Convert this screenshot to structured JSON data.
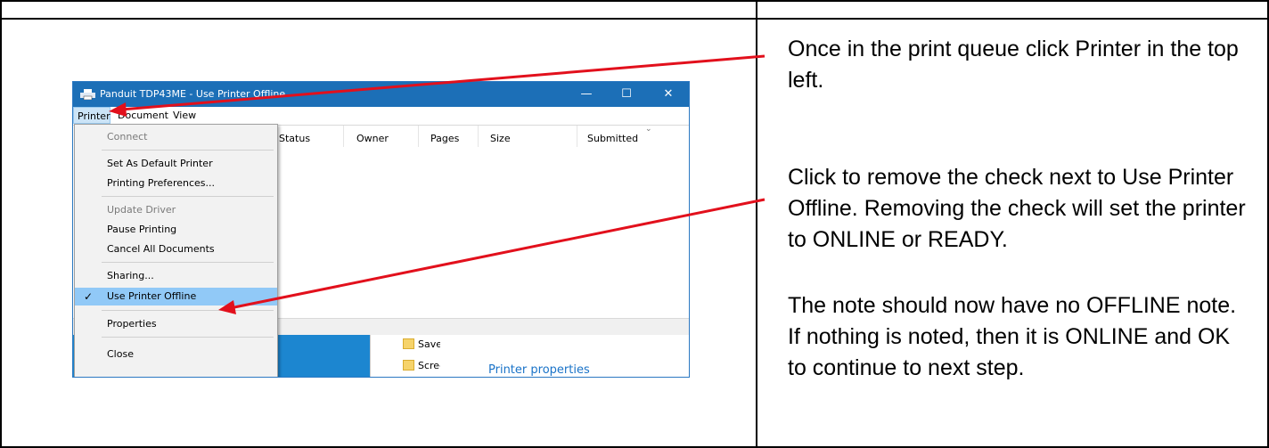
{
  "instructions": [
    "Once in the print queue click Printer in the top left.",
    "Click to remove the check next to Use Printer Offline.  Removing the check will set the printer to ONLINE or READY.",
    "The note should now have no OFFLINE note.  If nothing is noted, then it is ONLINE and OK to continue to next step."
  ],
  "window": {
    "title": "Panduit TDP43ME  - Use Printer Offline",
    "buttons": {
      "minimize": "—",
      "maximize": "☐",
      "close": "✕"
    },
    "menubar": [
      "Printer",
      "Document",
      "View"
    ],
    "columns": [
      "Status",
      "Owner",
      "Pages",
      "Size",
      "Submitted"
    ],
    "dropdown": [
      {
        "label": "Connect",
        "disabled": true
      },
      {
        "label": "Set As Default Printer"
      },
      {
        "label": "Printing Preferences..."
      },
      {
        "label": "Update Driver",
        "disabled": true
      },
      {
        "label": "Pause Printing"
      },
      {
        "label": "Cancel All Documents"
      },
      {
        "label": "Sharing..."
      },
      {
        "label": "Use Printer Offline",
        "checked": true,
        "highlighted": true
      },
      {
        "label": "Properties"
      },
      {
        "label": "Close"
      }
    ],
    "explorer": {
      "folders": [
        "Saved Pi",
        "Screensh"
      ],
      "printer_properties": "Printer properties"
    }
  },
  "colors": {
    "titlebar": "#1c6fb7",
    "annotation_arrow": "#e2101c",
    "menu_highlight": "#91c9f7"
  },
  "icons": [
    "printer-icon",
    "check-icon",
    "folder-icon",
    "chevron-right-icon",
    "chevron-down-icon"
  ]
}
